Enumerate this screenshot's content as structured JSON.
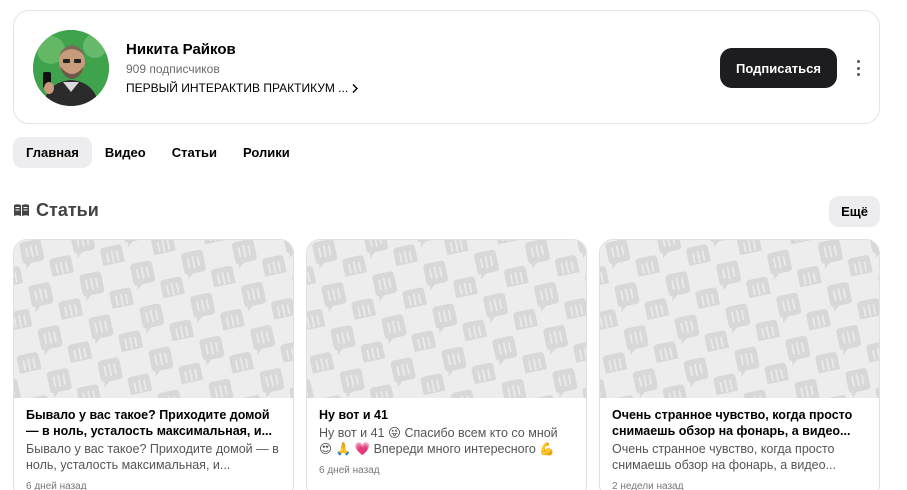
{
  "profile": {
    "name": "Никита Райков",
    "subscribers": "909 подписчиков",
    "description": "ПЕРВЫЙ ИНТЕРАКТИВ ПРАКТИКУМ ...",
    "subscribe_label": "Подписаться",
    "avatar_icon": "user-avatar-photo",
    "more_icon": "kebab-menu-icon"
  },
  "tabs": [
    {
      "label": "Главная",
      "active": true
    },
    {
      "label": "Видео",
      "active": false
    },
    {
      "label": "Статьи",
      "active": false
    },
    {
      "label": "Ролики",
      "active": false
    }
  ],
  "section": {
    "title": "Статьи",
    "icon": "book-icon",
    "more_label": "Ещё"
  },
  "cards": [
    {
      "title": "Бывало у вас такое? Приходите домой — в ноль, усталость максимальная, и...",
      "snippet": "Бывало у вас такое? Приходите домой — в ноль, усталость максимальная, и...",
      "date": "6 дней назад"
    },
    {
      "title": "Ну вот и 41",
      "snippet": "Ну вот и 41 😜 Спасибо всем кто со мной 😍 🙏 💗 Впереди много интересного 💪",
      "date": "6 дней назад"
    },
    {
      "title": "Очень странное чувство, когда просто снимаешь обзор на фонарь, а видео...",
      "snippet": "Очень странное чувство, когда просто снимаешь обзор на фонарь, а видео...",
      "date": "2 недели назад"
    }
  ],
  "colors": {
    "accent_button": "#1d1d1f",
    "tab_active_bg": "#ededf0",
    "thumb_bg": "#ededed",
    "thumb_pattern": "#d9d9d9"
  }
}
